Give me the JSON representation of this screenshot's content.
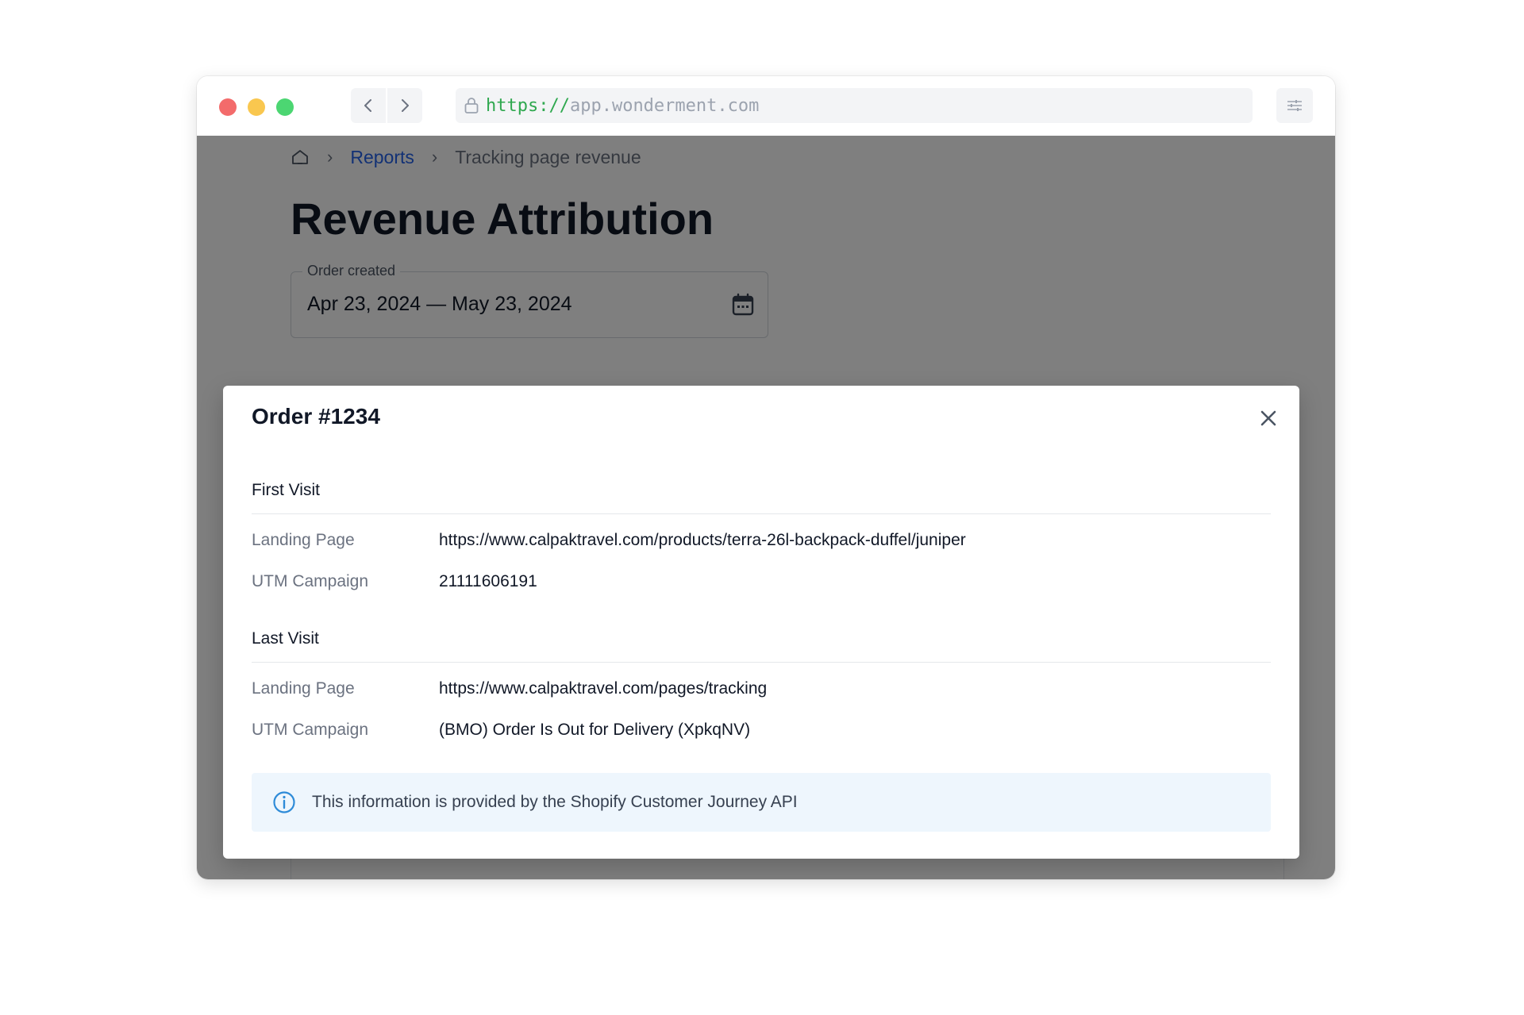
{
  "browser": {
    "url_scheme": "https://",
    "url_host": "app.wonderment.com"
  },
  "breadcrumb": {
    "home_icon": "home-icon",
    "items": [
      {
        "label": "Reports"
      },
      {
        "label": "Tracking page revenue"
      }
    ],
    "separator": "›"
  },
  "page": {
    "title": "Revenue Attribution"
  },
  "date_filter": {
    "label": "Order created",
    "value": "Apr 23, 2024 — May 23, 2024",
    "icon": "calendar-icon"
  },
  "modal": {
    "title": "Order #1234",
    "close_icon": "close-icon",
    "first_visit": {
      "heading": "First Visit",
      "landing_page_label": "Landing Page",
      "landing_page_value": "https://www.calpaktravel.com/products/terra-26l-backpack-duffel/juniper",
      "utm_campaign_label": "UTM Campaign",
      "utm_campaign_value": "21111606191"
    },
    "last_visit": {
      "heading": "Last Visit",
      "landing_page_label": "Landing Page",
      "landing_page_value": "https://www.calpaktravel.com/pages/tracking",
      "utm_campaign_label": "UTM Campaign",
      "utm_campaign_value": "(BMO) Order Is Out for Delivery (XpkqNV)"
    },
    "info_banner": {
      "icon": "info-icon",
      "text": "This information is provided by the Shopify Customer Journey API",
      "accent_color": "#2e8bd8"
    }
  }
}
